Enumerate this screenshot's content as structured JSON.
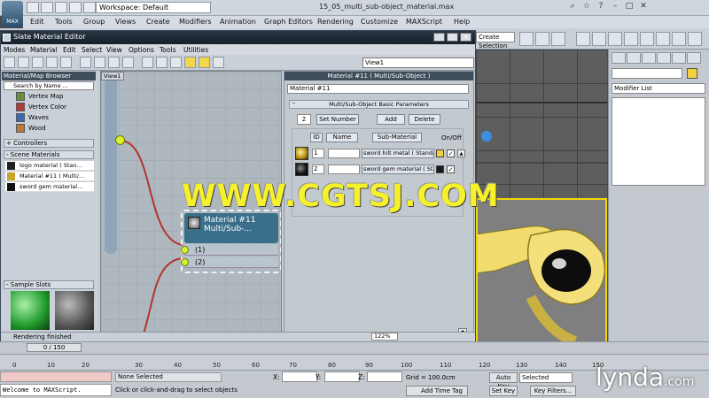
{
  "app": {
    "logo_label": "MAX",
    "workspace": "Workspace: Default",
    "file_title": "15_05_multi_sub-object_material.max"
  },
  "main_menu": {
    "items": [
      "Edit",
      "Tools",
      "Group",
      "Views",
      "Create",
      "Modifiers",
      "Animation",
      "Graph Editors",
      "Rendering",
      "Customize",
      "MAXScript",
      "Help"
    ]
  },
  "main_toolbar": {
    "selection_set": "Create Selection Se"
  },
  "command_panel": {
    "modifier_list": "Modifier List",
    "object_color": "#f2d13a"
  },
  "slate": {
    "title": "Slate Material Editor",
    "menu": [
      "Modes",
      "Material",
      "Edit",
      "Select",
      "View",
      "Options",
      "Tools",
      "Utilities"
    ],
    "view_dropdown": "View1",
    "browser": {
      "title": "Material/Map Browser",
      "search_placeholder": "Search by Name ...",
      "maps": [
        {
          "label": "Vertex Map",
          "swatch": "#6a8f3c"
        },
        {
          "label": "Vertex Color",
          "swatch": "#b53a3a"
        },
        {
          "label": "Waves",
          "swatch": "#3c6ab5"
        },
        {
          "label": "Wood",
          "swatch": "#b57a3a"
        }
      ],
      "controllers_label": "+ Controllers",
      "scene_materials_label": "- Scene Materials",
      "scene_materials": [
        {
          "label": "logo material ( Stan...",
          "swatch": "#222222"
        },
        {
          "label": "Material #11 ( Multi/...",
          "swatch": "#c9a52a"
        },
        {
          "label": "sword gem material...",
          "swatch": "#111111"
        }
      ],
      "sample_slots_label": "- Sample Slots"
    },
    "view1_tab": "View1",
    "node": {
      "title_line1": "Material #11",
      "title_line2": "Multi/Sub-...",
      "slots": [
        "(1)",
        "(2)"
      ]
    },
    "params": {
      "title": "Material #11  ( Multi/Sub-Object )",
      "material_name": "Material #11",
      "rollout": "Multi/Sub-Object Basic Parameters",
      "count": "2",
      "set_number": "Set Number",
      "add": "Add",
      "delete": "Delete",
      "col_id": "ID",
      "col_name": "Name",
      "col_submaterial": "Sub-Material",
      "col_onoff": "On/Off",
      "rows": [
        {
          "id": "1",
          "material": "sword hilt metal  ( Standard )",
          "color": "#f2d13a",
          "on": "✓"
        },
        {
          "id": "2",
          "material": "sword gem material  ( Standard )",
          "color": "#1a1a1a",
          "on": "✓"
        }
      ]
    },
    "status": "Rendering finished",
    "zoom": "122%"
  },
  "timeline": {
    "frame": "0 / 150",
    "ticks": [
      "0",
      "10",
      "20",
      "30",
      "40",
      "50",
      "60",
      "70",
      "80",
      "90",
      "100",
      "110",
      "120",
      "130",
      "140",
      "150"
    ]
  },
  "status_bar": {
    "maxscript_output": "Welcome to MAXScript.",
    "selection": "None Selected",
    "prompt": "Click or click-and-drag to select objects",
    "x_label": "X:",
    "y_label": "Y:",
    "z_label": "Z:",
    "grid": "Grid = 100.0cm",
    "add_time_tag": "Add Time Tag",
    "auto_key": "Auto Key",
    "set_key": "Set Key",
    "selected": "Selected",
    "key_filters": "Key Filters..."
  },
  "watermark": "WWW.CGTSJ.COM",
  "brand": "lynda",
  "brand_suffix": ".com"
}
